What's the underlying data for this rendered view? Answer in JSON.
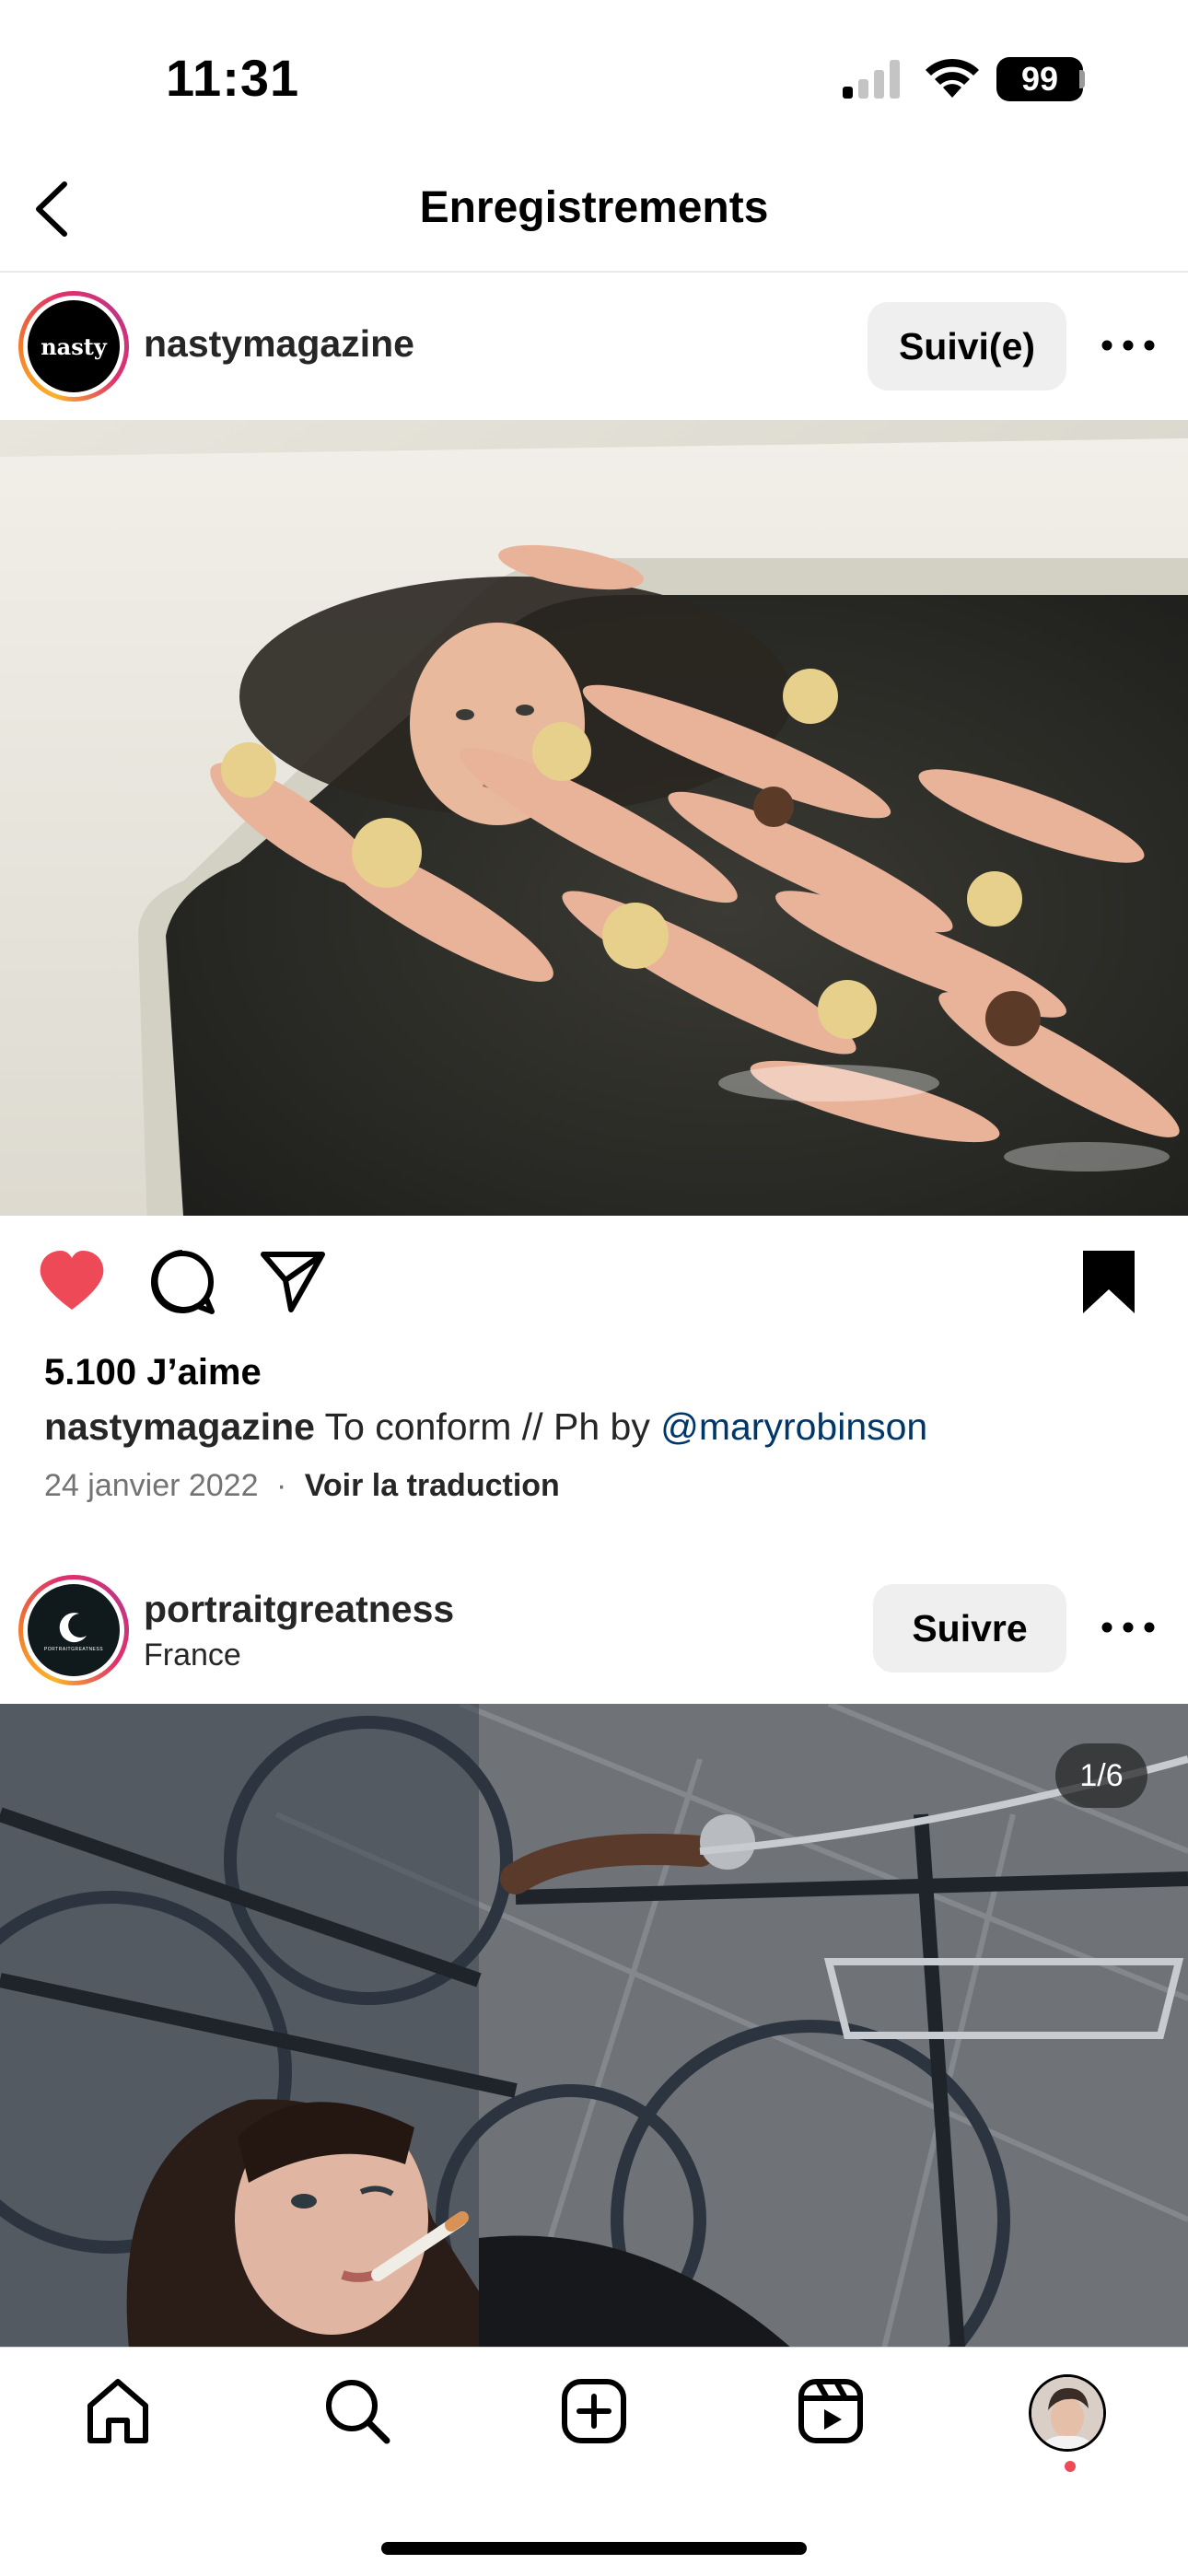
{
  "status_bar": {
    "time": "11:31",
    "battery": "99"
  },
  "header": {
    "title": "Enregistrements"
  },
  "post1": {
    "username": "nastymagazine",
    "avatar_text": "nasty",
    "follow_label": "Suivi(e)",
    "liked": true,
    "saved": true,
    "likes": "5.100 J’aime",
    "caption_user": "nastymagazine",
    "caption_text": "To conform // Ph by ",
    "caption_mention": "@maryrobinson",
    "date": "24 janvier 2022",
    "separator": "·",
    "see_translation": "Voir la traduction"
  },
  "post2": {
    "username": "portraitgreatness",
    "avatar_text": "PORTRAITGREATNESS",
    "location": "France",
    "follow_label": "Suivre",
    "carousel_counter": "1/6"
  },
  "colors": {
    "like_red": "#ed4956",
    "link_blue": "#00376b",
    "pill_bg": "#efefef",
    "muted_text": "#737373"
  },
  "icons": {
    "back": "chevron-left-icon",
    "more": "ellipsis-icon",
    "like": "heart-filled-icon",
    "comment": "comment-bubble-icon",
    "share": "paper-plane-icon",
    "save": "bookmark-filled-icon",
    "tabs": [
      "home-icon",
      "search-icon",
      "create-icon",
      "reels-icon",
      "profile-avatar"
    ]
  }
}
